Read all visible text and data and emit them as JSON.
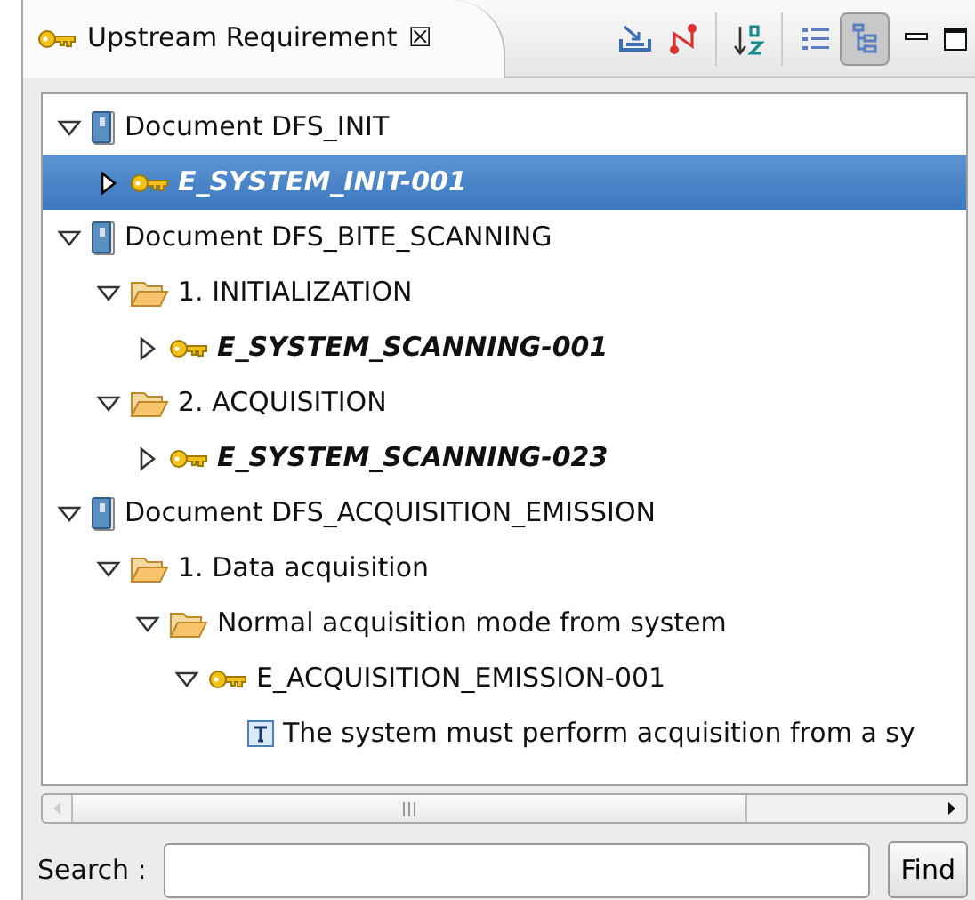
{
  "view_tab": {
    "title": "Upstream Requirement",
    "close": "☒"
  },
  "toolbar": [
    {
      "kind": "import",
      "selected": false
    },
    {
      "kind": "link",
      "selected": false
    },
    {
      "kind": "sort",
      "selected": false
    },
    {
      "kind": "list",
      "selected": false
    },
    {
      "kind": "tree",
      "selected": true
    }
  ],
  "tree": [
    {
      "kind": "document",
      "label": "Document DFS_INIT",
      "expanded": true,
      "selected": false,
      "children": [
        {
          "kind": "requirement",
          "label": "E_SYSTEM_INIT-001",
          "expanded": false,
          "selected": true,
          "emphasized": true
        }
      ]
    },
    {
      "kind": "document",
      "label": "Document DFS_BITE_SCANNING",
      "expanded": true,
      "selected": false,
      "children": [
        {
          "kind": "folder",
          "label": "1. INITIALIZATION",
          "expanded": true,
          "selected": false,
          "children": [
            {
              "kind": "requirement",
              "label": "E_SYSTEM_SCANNING-001",
              "expanded": false,
              "selected": false,
              "emphasized": true
            }
          ]
        },
        {
          "kind": "folder",
          "label": "2. ACQUISITION",
          "expanded": true,
          "selected": false,
          "children": [
            {
              "kind": "requirement",
              "label": "E_SYSTEM_SCANNING-023",
              "expanded": false,
              "selected": false,
              "emphasized": true
            }
          ]
        }
      ]
    },
    {
      "kind": "document",
      "label": "Document DFS_ACQUISITION_EMISSION",
      "expanded": true,
      "selected": false,
      "children": [
        {
          "kind": "folder",
          "label": "1. Data acquisition",
          "expanded": true,
          "selected": false,
          "children": [
            {
              "kind": "folder",
              "label": "Normal acquisition mode from system",
              "expanded": true,
              "selected": false,
              "children": [
                {
                  "kind": "requirement",
                  "label": "E_ACQUISITION_EMISSION-001",
                  "expanded": true,
                  "selected": false,
                  "emphasized": false,
                  "children": [
                    {
                      "kind": "text",
                      "label": "The system must perform acquisition from a sy",
                      "selected": false
                    }
                  ]
                }
              ]
            }
          ]
        }
      ]
    }
  ],
  "search": {
    "label": "Search :",
    "button": "Find"
  }
}
